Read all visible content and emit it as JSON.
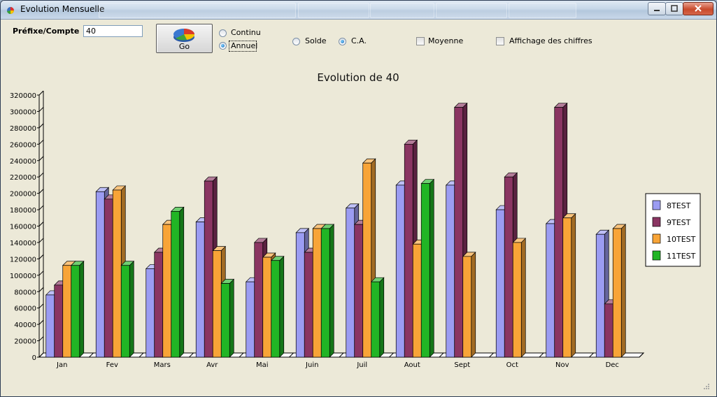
{
  "window": {
    "title": "Evolution Mensuelle"
  },
  "form": {
    "prefix_label": "Préfixe/Compte",
    "prefix_value": "40",
    "go_label": "Go",
    "mode_continu": "Continu",
    "mode_annuel": "Annuel",
    "mode_selected": "Annuel",
    "type_solde": "Solde",
    "type_ca": "C.A.",
    "type_selected": "C.A.",
    "moyenne_label": "Moyenne",
    "moyenne_checked": false,
    "affichage_label": "Affichage des chiffres",
    "affichage_checked": false
  },
  "colors": {
    "8TEST": "#9b9cf2",
    "9TEST": "#8a3562",
    "10TEST": "#f8a437",
    "11TEST": "#21b525"
  },
  "chart_data": {
    "type": "bar",
    "title": "Evolution de 40",
    "categories": [
      "Jan",
      "Fev",
      "Mars",
      "Avr",
      "Mai",
      "Juin",
      "Juil",
      "Aout",
      "Sept",
      "Oct",
      "Nov",
      "Dec"
    ],
    "series": [
      {
        "name": "8TEST",
        "values": [
          76000,
          202000,
          108000,
          165000,
          92000,
          152000,
          182000,
          210000,
          210000,
          180000,
          163000,
          150000
        ]
      },
      {
        "name": "9TEST",
        "values": [
          88000,
          193000,
          128000,
          215000,
          140000,
          128000,
          162000,
          260000,
          305000,
          220000,
          305000,
          65000
        ]
      },
      {
        "name": "10TEST",
        "values": [
          112000,
          204000,
          162000,
          130000,
          122000,
          157000,
          237000,
          138000,
          123000,
          140000,
          170000,
          157000
        ]
      },
      {
        "name": "11TEST",
        "values": [
          112000,
          112000,
          178000,
          90000,
          118000,
          157000,
          92000,
          212000,
          null,
          null,
          null,
          null
        ]
      }
    ],
    "ylim": [
      0,
      320000
    ],
    "yticks": [
      0,
      20000,
      40000,
      60000,
      80000,
      100000,
      120000,
      140000,
      160000,
      180000,
      200000,
      220000,
      240000,
      260000,
      280000,
      300000,
      320000
    ],
    "xlabel": "",
    "ylabel": "",
    "legend_position": "right",
    "grid": false
  }
}
